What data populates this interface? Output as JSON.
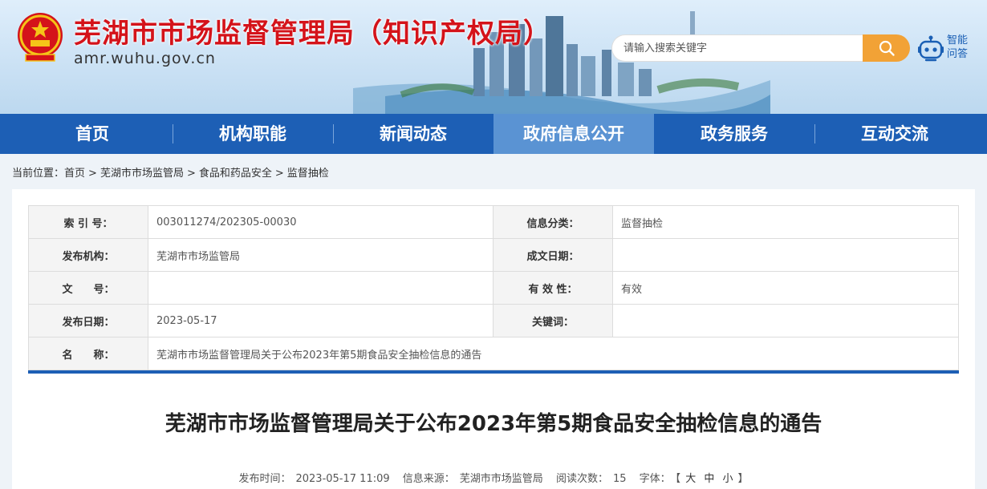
{
  "header": {
    "title": "芜湖市市场监督管理局（知识产权局）",
    "domain": "amr.wuhu.gov.cn",
    "search_placeholder": "请输入搜索关键字",
    "qa_label": "智能问答"
  },
  "nav": {
    "items": [
      {
        "label": "首页"
      },
      {
        "label": "机构职能"
      },
      {
        "label": "新闻动态"
      },
      {
        "label": "政府信息公开"
      },
      {
        "label": "政务服务"
      },
      {
        "label": "互动交流"
      }
    ],
    "active_index": 3
  },
  "breadcrumb": {
    "prefix": "当前位置：",
    "items": [
      "首页",
      "芜湖市市场监管局",
      "食品和药品安全",
      "监督抽检"
    ],
    "separator": ">"
  },
  "meta": {
    "index_label": "索 引 号：",
    "index_value": "003011274/202305-00030",
    "category_label": "信息分类：",
    "category_value": "监督抽检",
    "publisher_label": "发布机构：",
    "publisher_value": "芜湖市市场监管局",
    "created_label": "成文日期：",
    "created_value": "",
    "docno_label": "文　　号：",
    "docno_value": "",
    "validity_label": "有 效 性：",
    "validity_value": "有效",
    "pubdate_label": "发布日期：",
    "pubdate_value": "2023-05-17",
    "keywords_label": "关键词：",
    "keywords_value": "",
    "name_label": "名　　称：",
    "name_value": "芜湖市市场监督管理局关于公布2023年第5期食品安全抽检信息的通告"
  },
  "article": {
    "title": "芜湖市市场监督管理局关于公布2023年第5期食品安全抽检信息的通告",
    "time_label": "发布时间：",
    "time_value": "2023-05-17 11:09",
    "source_label": "信息来源：",
    "source_value": "芜湖市市场监管局",
    "views_label": "阅读次数：",
    "views_value": "15",
    "font_label": "字体：",
    "font_open": "【",
    "font_large": "大",
    "font_medium": "中",
    "font_small": "小",
    "font_close": "】"
  },
  "colors": {
    "nav_bg": "#1d5fb5",
    "nav_active": "#5a93d3",
    "title_red": "#d4131a",
    "search_orange": "#f2a236"
  }
}
